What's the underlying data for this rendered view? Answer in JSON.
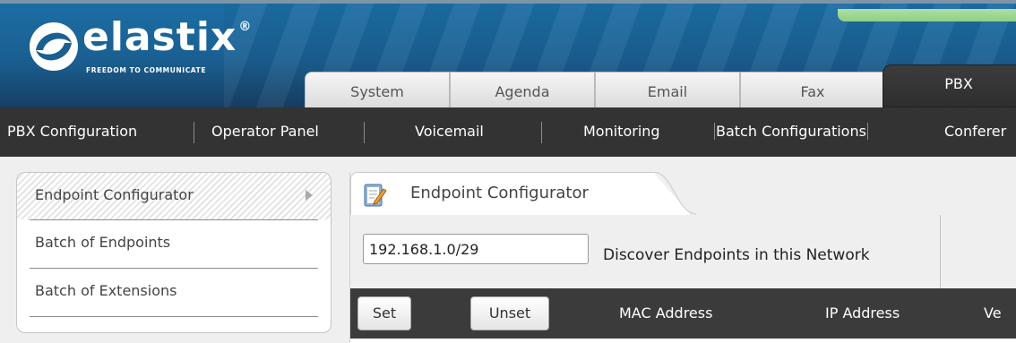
{
  "app": {
    "logo_text": "elastix",
    "logo_registered": "®",
    "tagline": "FREEDOM TO COMMUNICATE"
  },
  "nav_tabs": [
    {
      "label": "System"
    },
    {
      "label": "Agenda"
    },
    {
      "label": "Email"
    },
    {
      "label": "Fax"
    },
    {
      "label": "PBX",
      "active": true
    }
  ],
  "submenu": [
    {
      "label": "PBX Configuration"
    },
    {
      "label": "Operator Panel"
    },
    {
      "label": "Voicemail"
    },
    {
      "label": "Monitoring"
    },
    {
      "label": "Batch Configurations",
      "selected": true
    },
    {
      "label": "Conferer"
    }
  ],
  "sidebar": {
    "items": [
      {
        "label": "Endpoint Configurator",
        "active": true
      },
      {
        "label": "Batch of Endpoints"
      },
      {
        "label": "Batch of Extensions"
      }
    ]
  },
  "main": {
    "tab_title": "Endpoint Configurator",
    "tab_icon": "notepad-pencil-icon",
    "network_input_value": "192.168.1.0/29",
    "discover_label": "Discover Endpoints in this Network",
    "set_label": "Set",
    "unset_label": "Unset",
    "columns": [
      "MAC Address",
      "IP Address",
      "Ve"
    ]
  },
  "colors": {
    "header_blue": "#1a5f91",
    "submenu_bg": "#333333",
    "table_head_bg": "#3b3b3b"
  }
}
